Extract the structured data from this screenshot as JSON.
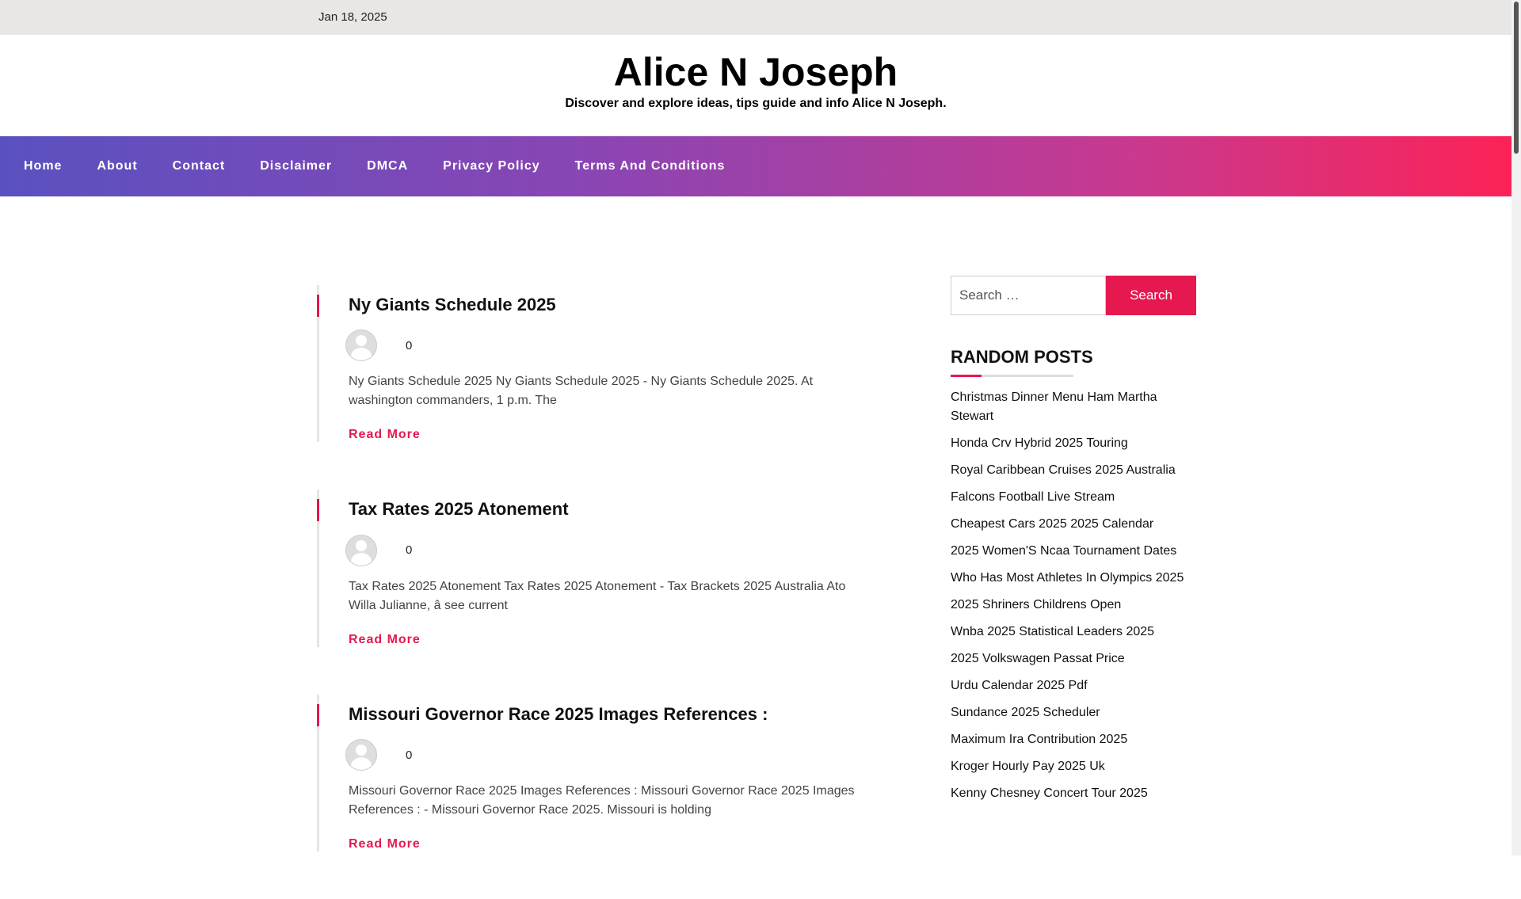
{
  "topbar": {
    "date": "Jan 18, 2025"
  },
  "site": {
    "title": "Alice N Joseph",
    "tagline": "Discover and explore ideas, tips guide and info Alice N Joseph."
  },
  "nav": [
    "Home",
    "About",
    "Contact",
    "Disclaimer",
    "DMCA",
    "Privacy Policy",
    "Terms And Conditions"
  ],
  "posts": [
    {
      "title": "Ny Giants Schedule 2025",
      "comments": "0",
      "excerpt": "Ny Giants Schedule 2025 Ny Giants Schedule 2025 - Ny Giants Schedule 2025. At washington commanders, 1 p.m. The",
      "read_more": "Read More"
    },
    {
      "title": "Tax Rates 2025 Atonement",
      "comments": "0",
      "excerpt": "Tax Rates 2025 Atonement Tax Rates 2025 Atonement - Tax Brackets 2025 Australia Ato Willa Julianne,  â see current",
      "read_more": "Read More"
    },
    {
      "title": "Missouri Governor Race 2025 Images References :",
      "comments": "0",
      "excerpt": "Missouri Governor Race 2025 Images References : Missouri Governor Race 2025 Images References : - Missouri Governor Race 2025. Missouri is holding",
      "read_more": "Read More"
    }
  ],
  "sidebar": {
    "search_placeholder": "Search …",
    "search_button": "Search",
    "random_title": "RANDOM POSTS",
    "random_posts": [
      "Christmas Dinner Menu Ham Martha Stewart",
      "Honda Crv Hybrid 2025 Touring",
      "Royal Caribbean Cruises 2025 Australia",
      "Falcons Football Live Stream",
      "Cheapest Cars 2025 2025 Calendar",
      "2025 Women'S Ncaa Tournament Dates",
      "Who Has Most Athletes In Olympics 2025",
      "2025 Shriners Childrens Open",
      "Wnba 2025 Statistical Leaders 2025",
      "2025 Volkswagen Passat Price",
      "Urdu Calendar 2025 Pdf",
      "Sundance 2025 Scheduler",
      "Maximum Ira Contribution 2025",
      "Kroger Hourly Pay 2025 Uk",
      "Kenny Chesney Concert Tour 2025"
    ]
  },
  "colors": {
    "accent": "#e5194f",
    "nav_gradient_start": "#5a51c0",
    "nav_gradient_end": "#fc2257",
    "topbar_bg": "#e9e6e6"
  }
}
